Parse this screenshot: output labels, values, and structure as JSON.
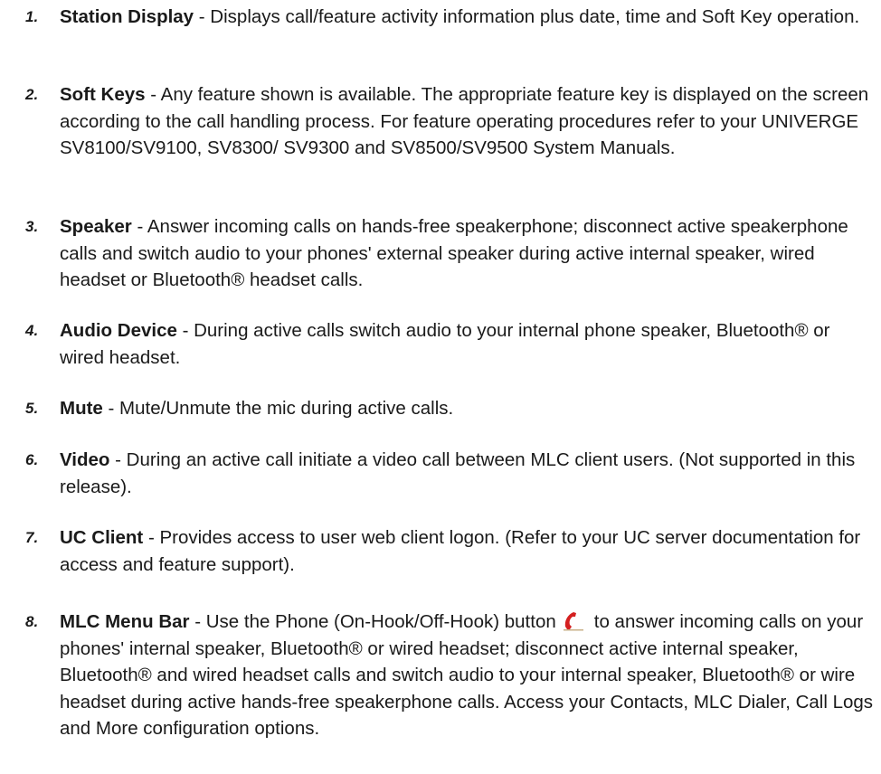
{
  "items": [
    {
      "number": "1.",
      "term": "Station Display",
      "desc": " - Displays call/feature activity information plus date, time and Soft Key operation."
    },
    {
      "number": "2.",
      "term": "Soft Keys",
      "desc": " - Any feature shown is available. The appropriate feature key is displayed on the screen according to the call handling process. For feature operating procedures refer to your UNIVERGE SV8100/SV9100, SV8300/ SV9300 and SV8500/SV9500 System Manuals."
    },
    {
      "number": "3.",
      "term": "Speaker",
      "desc": " - Answer incoming calls on hands-free speakerphone; disconnect active speakerphone calls and switch audio to your phones' external speaker during active internal speaker, wired headset or Bluetooth® headset calls."
    },
    {
      "number": "4.",
      "term": "Audio Device",
      "desc": " - During active calls switch audio to your internal phone speaker, Bluetooth® or wired headset."
    },
    {
      "number": "5.",
      "term": "Mute",
      "desc": " - Mute/Unmute the mic during active calls."
    },
    {
      "number": "6.",
      "term": "Video",
      "desc": " - During an active call initiate a video call between MLC client users. (Not supported in this release)."
    },
    {
      "number": "7.",
      "term": "UC Client",
      "desc": " - Provides access to user web client logon. (Refer to your UC server documentation for access and feature support)."
    },
    {
      "number": "8.",
      "term": "MLC Menu Bar",
      "desc_before_icon": " - Use the Phone (On-Hook/Off-Hook) button",
      "desc_after_icon": "to answer incoming calls on your phones' internal speaker, Bluetooth® or wired headset; disconnect active internal speaker, Bluetooth® and wired headset calls and switch audio to your internal speaker, Bluetooth® or wire headset during active hands-free speakerphone calls. Access your Contacts, MLC Dialer, Call Logs and More configuration options.",
      "icon": "phone-handset-icon",
      "icon_color": "#d42020"
    }
  ]
}
